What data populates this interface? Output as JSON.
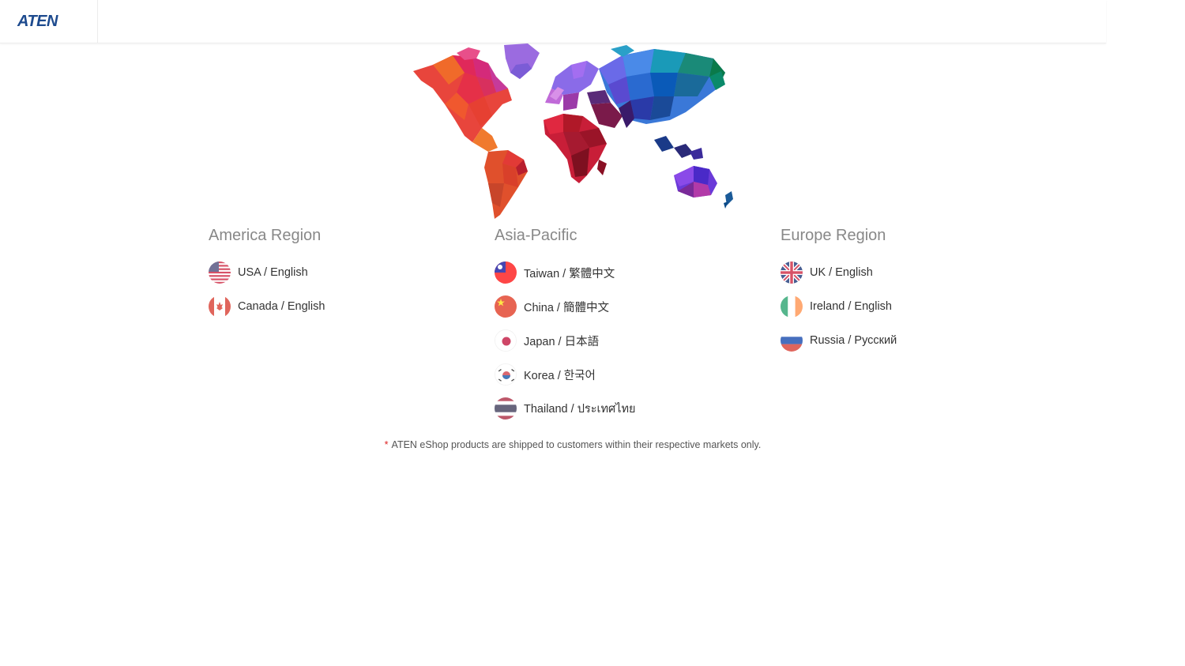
{
  "header": {
    "logo_text": "ATEN"
  },
  "regions": [
    {
      "title": "America Region",
      "countries": [
        {
          "label": "USA / English",
          "flag": "usa-flag-icon"
        },
        {
          "label": "Canada / English",
          "flag": "canada-flag-icon"
        }
      ]
    },
    {
      "title": "Asia-Pacific",
      "countries": [
        {
          "label": "Taiwan / 繁體中文",
          "flag": "taiwan-flag-icon"
        },
        {
          "label": "China / 簡體中文",
          "flag": "china-flag-icon"
        },
        {
          "label": "Japan / 日本語",
          "flag": "japan-flag-icon"
        },
        {
          "label": "Korea / 한국어",
          "flag": "korea-flag-icon"
        },
        {
          "label": "Thailand / ประเทศไทย",
          "flag": "thailand-flag-icon"
        }
      ]
    },
    {
      "title": "Europe Region",
      "countries": [
        {
          "label": "UK / English",
          "flag": "uk-flag-icon"
        },
        {
          "label": "Ireland / English",
          "flag": "ireland-flag-icon"
        },
        {
          "label": "Russia / Русский",
          "flag": "russia-flag-icon"
        }
      ]
    }
  ],
  "note": {
    "star": "*",
    "text": "ATEN eShop products are shipped to customers within their respective markets only."
  },
  "colors": {
    "brand": "#1d4a8e",
    "note_star": "#dd2222"
  }
}
